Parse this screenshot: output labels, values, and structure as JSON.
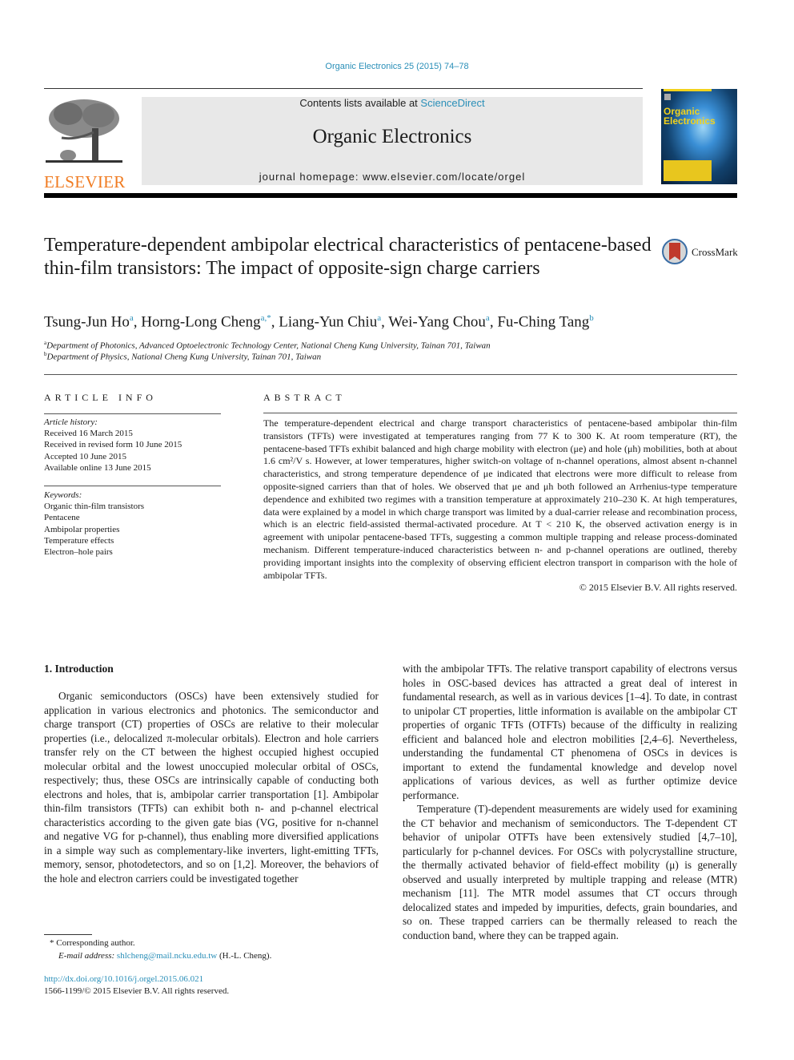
{
  "header": {
    "journal_ref": "Organic Electronics 25 (2015) 74–78",
    "contents_prefix": "Contents lists available at ",
    "contents_link": "ScienceDirect",
    "journal_name": "Organic Electronics",
    "homepage": "journal homepage: www.elsevier.com/locate/orgel",
    "publisher_logo": "ELSEVIER",
    "cover_title_line1": "Organic",
    "cover_title_line2": "Electronics",
    "crossmark_label": "CrossMark"
  },
  "article": {
    "title": "Temperature-dependent ambipolar electrical characteristics of pentacene-based thin-film transistors: The impact of opposite-sign charge carriers",
    "authors": [
      {
        "name": "Tsung-Jun Ho",
        "aff": "a"
      },
      {
        "name": "Horng-Long Cheng",
        "aff": "a,*"
      },
      {
        "name": "Liang-Yun Chiu",
        "aff": "a"
      },
      {
        "name": "Wei-Yang Chou",
        "aff": "a"
      },
      {
        "name": "Fu-Ching Tang",
        "aff": "b"
      }
    ],
    "affiliations": [
      {
        "key": "a",
        "text": "Department of Photonics, Advanced Optoelectronic Technology Center, National Cheng Kung University, Tainan 701, Taiwan"
      },
      {
        "key": "b",
        "text": "Department of Physics, National Cheng Kung University, Tainan 701, Taiwan"
      }
    ]
  },
  "article_info": {
    "heading": "ARTICLE INFO",
    "history_label": "Article history:",
    "history": [
      "Received 16 March 2015",
      "Received in revised form 10 June 2015",
      "Accepted 10 June 2015",
      "Available online 13 June 2015"
    ],
    "keywords_label": "Keywords:",
    "keywords": [
      "Organic thin-film transistors",
      "Pentacene",
      "Ambipolar properties",
      "Temperature effects",
      "Electron–hole pairs"
    ]
  },
  "abstract": {
    "heading": "ABSTRACT",
    "text": "The temperature-dependent electrical and charge transport characteristics of pentacene-based ambipolar thin-film transistors (TFTs) were investigated at temperatures ranging from 77 K to 300 K. At room temperature (RT), the pentacene-based TFTs exhibit balanced and high charge mobility with electron (μe) and hole (μh) mobilities, both at about 1.6 cm²/V s. However, at lower temperatures, higher switch-on voltage of n-channel operations, almost absent n-channel characteristics, and strong temperature dependence of μe indicated that electrons were more difficult to release from opposite-signed carriers than that of holes. We observed that μe and μh both followed an Arrhenius-type temperature dependence and exhibited two regimes with a transition temperature at approximately 210–230 K. At high temperatures, data were explained by a model in which charge transport was limited by a dual-carrier release and recombination process, which is an electric field-assisted thermal-activated procedure. At T < 210 K, the observed activation energy is in agreement with unipolar pentacene-based TFTs, suggesting a common multiple trapping and release process-dominated mechanism. Different temperature-induced characteristics between n- and p-channel operations are outlined, thereby providing important insights into the complexity of observing efficient electron transport in comparison with the hole of ambipolar TFTs.",
    "copyright": "© 2015 Elsevier B.V. All rights reserved."
  },
  "body": {
    "section_heading": "1. Introduction",
    "left_column": [
      "Organic semiconductors (OSCs) have been extensively studied for application in various electronics and photonics. The semiconductor and charge transport (CT) properties of OSCs are relative to their molecular properties (i.e., delocalized π-molecular orbitals). Electron and hole carriers transfer rely on the CT between the highest occupied highest occupied molecular orbital and the lowest unoccupied molecular orbital of OSCs, respectively; thus, these OSCs are intrinsically capable of conducting both electrons and holes, that is, ambipolar carrier transportation [1]. Ambipolar thin-film transistors (TFTs) can exhibit both n- and p-channel electrical characteristics according to the given gate bias (VG, positive for n-channel and negative VG for p-channel), thus enabling more diversified applications in a simple way such as complementary-like inverters, light-emitting TFTs, memory, sensor, photodetectors, and so on [1,2]. Moreover, the behaviors of the hole and electron carriers could be investigated together"
    ],
    "right_column": [
      "with the ambipolar TFTs. The relative transport capability of electrons versus holes in OSC-based devices has attracted a great deal of interest in fundamental research, as well as in various devices [1–4]. To date, in contrast to unipolar CT properties, little information is available on the ambipolar CT properties of organic TFTs (OTFTs) because of the difficulty in realizing efficient and balanced hole and electron mobilities [2,4–6]. Nevertheless, understanding the fundamental CT phenomena of OSCs in devices is important to extend the fundamental knowledge and develop novel applications of various devices, as well as further optimize device performance.",
      "Temperature (T)-dependent measurements are widely used for examining the CT behavior and mechanism of semiconductors. The T-dependent CT behavior of unipolar OTFTs have been extensively studied [4,7–10], particularly for p-channel devices. For OSCs with polycrystalline structure, the thermally activated behavior of field-effect mobility (μ) is generally observed and usually interpreted by multiple trapping and release (MTR) mechanism [11]. The MTR model assumes that CT occurs through delocalized states and impeded by impurities, defects, grain boundaries, and so on. These trapped carriers can be thermally released to reach the conduction band, where they can be trapped again."
    ]
  },
  "footnotes": {
    "corresponding_mark": "*",
    "corresponding": "Corresponding author.",
    "email_label": "E-mail address: ",
    "email": "shlcheng@mail.ncku.edu.tw",
    "email_suffix": " (H.-L. Cheng).",
    "doi": "http://dx.doi.org/10.1016/j.orgel.2015.06.021",
    "issn": "1566-1199/© 2015 Elsevier B.V. All rights reserved."
  }
}
